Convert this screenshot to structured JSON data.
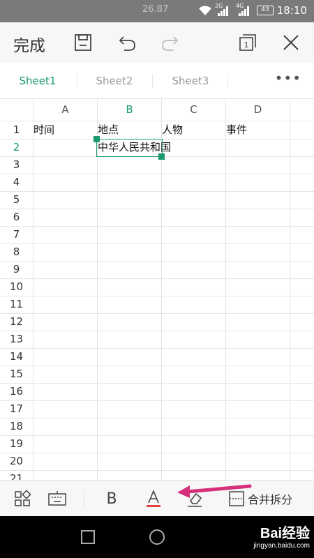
{
  "status_bar": {
    "time": "18:10",
    "battery": "43",
    "network_1": "2G",
    "network_2": "4G",
    "ghost_text": "26.87"
  },
  "toolbar": {
    "done_label": "完成"
  },
  "sheet_tabs": [
    {
      "label": "Sheet1",
      "active": true
    },
    {
      "label": "Sheet2",
      "active": false
    },
    {
      "label": "Sheet3",
      "active": false
    }
  ],
  "grid": {
    "columns": [
      "A",
      "B",
      "C",
      "D"
    ],
    "active_column": "B",
    "rows": [
      "1",
      "2",
      "3",
      "4",
      "5",
      "6",
      "7",
      "8",
      "9",
      "10",
      "11",
      "12",
      "13",
      "14",
      "15",
      "16",
      "17",
      "18",
      "19",
      "20",
      "21"
    ],
    "active_row": "2",
    "cells": {
      "A1": "时间",
      "B1": "地点",
      "C1": "人物",
      "D1": "事件",
      "B2": "中华人民共和国"
    }
  },
  "bottom_toolbar": {
    "bold_label": "B",
    "merge_label": "合并拆分",
    "font_color_accent": "#e0463d"
  },
  "watermark": {
    "brand": "Bai经验",
    "url": "jingyan.baidu.com"
  },
  "colors": {
    "accent": "#1a9a6c",
    "arrow": "#d6307a"
  }
}
